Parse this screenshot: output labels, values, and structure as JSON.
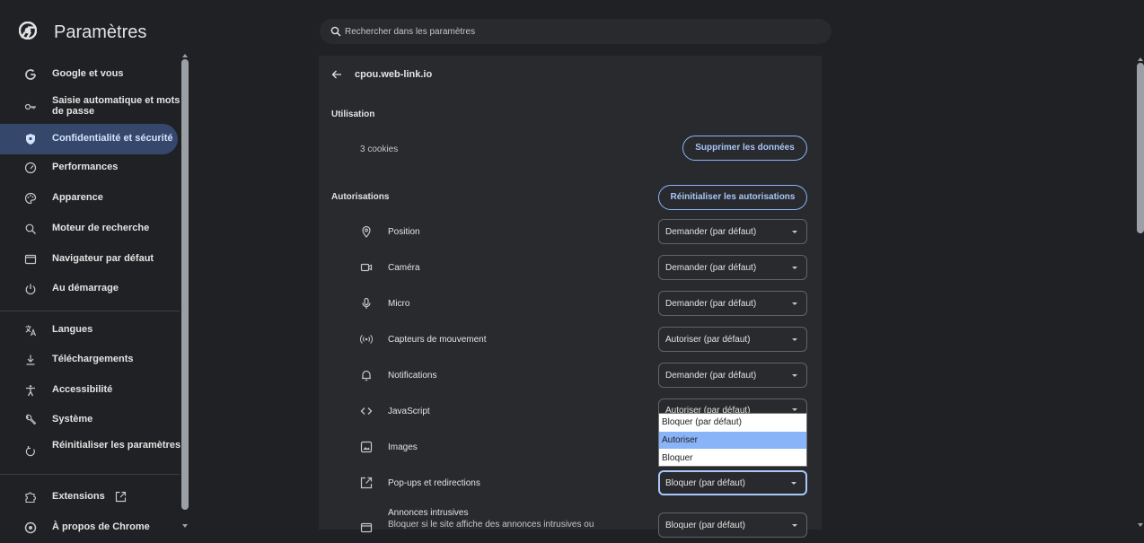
{
  "app": {
    "title": "Paramètres"
  },
  "search": {
    "placeholder": "Rechercher dans les paramètres"
  },
  "sidebar": {
    "items": [
      {
        "label": "Google et vous",
        "icon": "google-icon"
      },
      {
        "label": "Saisie automatique et mots de passe",
        "icon": "key-icon"
      },
      {
        "label": "Confidentialité et sécurité",
        "icon": "shield-icon",
        "active": true
      },
      {
        "label": "Performances",
        "icon": "speedometer-icon"
      },
      {
        "label": "Apparence",
        "icon": "palette-icon"
      },
      {
        "label": "Moteur de recherche",
        "icon": "search-icon"
      },
      {
        "label": "Navigateur par défaut",
        "icon": "browser-icon"
      },
      {
        "label": "Au démarrage",
        "icon": "power-icon"
      },
      {
        "label": "Langues",
        "icon": "translate-icon"
      },
      {
        "label": "Téléchargements",
        "icon": "download-icon"
      },
      {
        "label": "Accessibilité",
        "icon": "accessibility-icon"
      },
      {
        "label": "Système",
        "icon": "wrench-icon"
      },
      {
        "label": "Réinitialiser les paramètres",
        "icon": "reset-icon"
      },
      {
        "label": "Extensions",
        "icon": "puzzle-icon"
      },
      {
        "label": "À propos de Chrome",
        "icon": "chrome-icon"
      }
    ]
  },
  "site": {
    "name": "cpou.web-link.io",
    "usage_label": "Utilisation",
    "cookies": "3 cookies",
    "delete_button": "Supprimer les données",
    "permissions_label": "Autorisations",
    "reset_button": "Réinitialiser les autorisations"
  },
  "permissions": [
    {
      "label": "Position",
      "value": "Demander (par défaut)",
      "icon": "location-pin-icon"
    },
    {
      "label": "Caméra",
      "value": "Demander (par défaut)",
      "icon": "camera-icon"
    },
    {
      "label": "Micro",
      "value": "Demander (par défaut)",
      "icon": "microphone-icon"
    },
    {
      "label": "Capteurs de mouvement",
      "value": "Autoriser (par défaut)",
      "icon": "motion-sensor-icon"
    },
    {
      "label": "Notifications",
      "value": "Demander (par défaut)",
      "icon": "bell-icon"
    },
    {
      "label": "JavaScript",
      "value": "Autoriser (par défaut)",
      "icon": "code-icon"
    },
    {
      "label": "Images",
      "value": "",
      "icon": "image-icon"
    },
    {
      "label": "Pop-ups et redirections",
      "value": "Bloquer (par défaut)",
      "icon": "popup-icon"
    },
    {
      "label": "Annonces intrusives",
      "sub": "Bloquer si le site affiche des annonces intrusives ou",
      "value": "Bloquer (par défaut)",
      "icon": "ads-icon"
    }
  ],
  "dropdown": {
    "options": [
      "Bloquer (par défaut)",
      "Autoriser",
      "Bloquer"
    ],
    "highlighted": "Autoriser"
  },
  "colors": {
    "background": "#202124",
    "panel": "#292a2d",
    "accent": "#a8c7fa",
    "active_nav": "#35486b"
  }
}
